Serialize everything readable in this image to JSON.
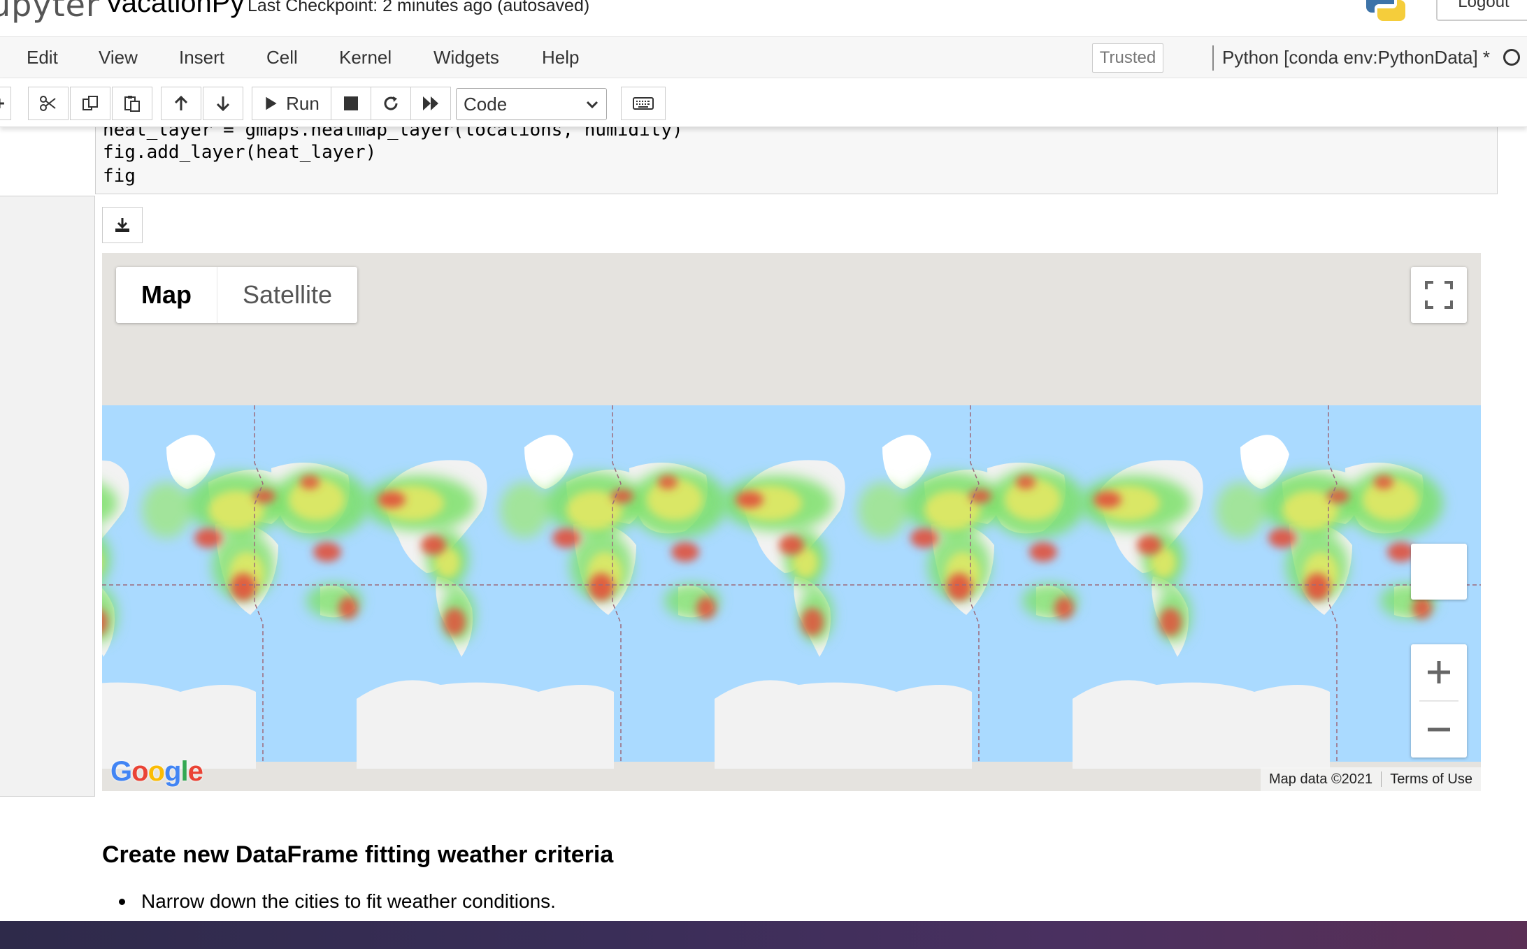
{
  "header": {
    "logo_text": "upyter",
    "notebook_name": "VacationPy",
    "checkpoint": "Last Checkpoint: 2 minutes ago  (autosaved)",
    "logout_label": "Logout"
  },
  "menubar": {
    "items": [
      "Edit",
      "View",
      "Insert",
      "Cell",
      "Kernel",
      "Widgets",
      "Help"
    ],
    "trusted_label": "Trusted",
    "kernel_name": "Python [conda env:PythonData] *"
  },
  "toolbar": {
    "run_label": "Run",
    "cell_type": "Code",
    "icons": [
      "plus-icon",
      "cut-icon",
      "copy-icon",
      "paste-icon",
      "arrow-up-icon",
      "arrow-down-icon",
      "play-icon",
      "stop-icon",
      "restart-icon",
      "fast-forward-icon",
      "chevron-down-icon",
      "keyboard-icon"
    ]
  },
  "code_cell": {
    "lines": [
      "heat_layer = gmaps.heatmap_layer(locations, humidity)",
      "fig.add_layer(heat_layer)",
      "fig"
    ]
  },
  "map": {
    "map_button": "Map",
    "satellite_button": "Satellite",
    "google_logo": [
      "G",
      "o",
      "o",
      "g",
      "l",
      "e"
    ],
    "google_colors": [
      "#4285F4",
      "#EA4335",
      "#FBBC05",
      "#4285F4",
      "#34A853",
      "#EA4335"
    ],
    "map_data": "Map data ©2021",
    "terms": "Terms of Use",
    "ocean_color": "#aadaff",
    "land_color": "#f2f2f2"
  },
  "markdown": {
    "heading": "Create new DataFrame fitting weather criteria",
    "list_item": "Narrow down the cities to fit weather conditions."
  }
}
